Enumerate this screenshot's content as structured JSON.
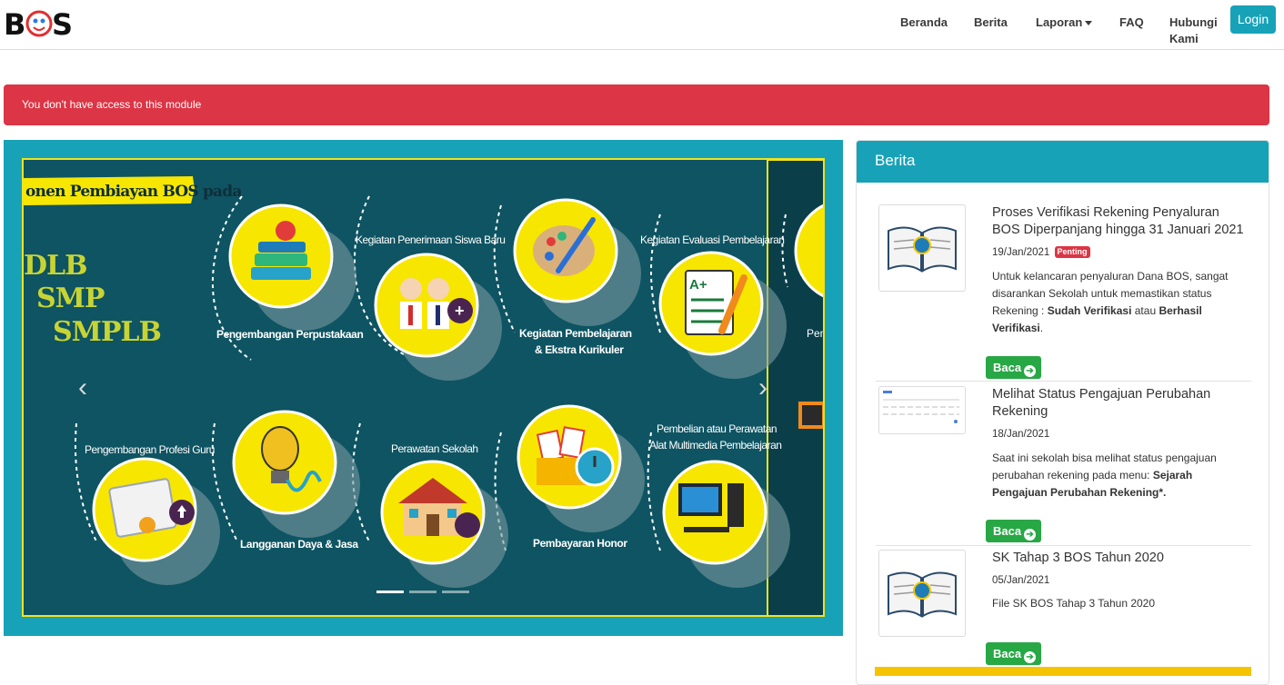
{
  "nav": {
    "logo_text": "BOS",
    "items": [
      {
        "label": "Beranda"
      },
      {
        "label": "Berita"
      },
      {
        "label": "Laporan"
      },
      {
        "label": "FAQ"
      },
      {
        "label": "Hubungi Kami"
      }
    ],
    "login_label": "Login"
  },
  "alert": {
    "message": "You don't have access to this module"
  },
  "carousel": {
    "banner_text": "onen Pembiayan BOS pada",
    "levels": [
      "DLB",
      "SMP",
      "SMPLB"
    ],
    "items": [
      {
        "label": "Pengembangan Perpustakaan",
        "icon": "books-apple-icon"
      },
      {
        "label": "Kegiatan Penerimaan Siswa Baru",
        "icon": "students-icon"
      },
      {
        "label": "Kegiatan Pembelajaran & Ekstra Kurikuler",
        "icon": "palette-icon"
      },
      {
        "label": "Kegiatan Evaluasi Pembelajaran",
        "icon": "exam-paper-icon"
      },
      {
        "label": "Pengembangan Profesi Guru",
        "icon": "certificate-icon"
      },
      {
        "label": "Langganan Daya & Jasa",
        "icon": "lightbulb-icon"
      },
      {
        "label": "Perawatan Sekolah",
        "icon": "school-building-icon"
      },
      {
        "label": "Pembayaran Honor",
        "icon": "envelope-money-icon"
      },
      {
        "label": "Pembelian atau Perawatan Alat Multimedia Pembelajaran",
        "icon": "computer-icon"
      }
    ],
    "partial_label": "Peng",
    "prev_label": "‹",
    "next_label": "›",
    "slide_count": 3,
    "active_slide": 1
  },
  "news": {
    "header": "Berita",
    "items": [
      {
        "title": "Proses Verifikasi Rekening Penyaluran BOS Diperpanjang hingga 31 Januari 2021",
        "date": "19/Jan/2021",
        "badge": "Penting",
        "desc_parts": [
          "Untuk kelancaran penyaluran Dana BOS, sangat disarankan Sekolah untuk memastikan status Rekening : ",
          "Sudah Verifikasi",
          " atau ",
          "Berhasil Verifikasi",
          "."
        ],
        "button": "Baca"
      },
      {
        "title": "Melihat Status Pengajuan Perubahan Rekening",
        "date": "18/Jan/2021",
        "desc_parts": [
          "Saat ini sekolah bisa melihat status pengajuan perubahan rekening pada menu: ",
          "Sejarah Pengajuan Perubahan Rekening*."
        ],
        "button": "Baca"
      },
      {
        "title": "SK Tahap 3 BOS Tahun 2020",
        "date": "05/Jan/2021",
        "desc_parts": [
          "File SK BOS Tahap 3 Tahun 2020"
        ],
        "button": "Baca"
      }
    ]
  },
  "colors": {
    "teal": "#17a2b8",
    "danger": "#dc3545",
    "success": "#28a745",
    "slide_bg": "#0e5462",
    "circle_yellow": "#f7e600"
  }
}
